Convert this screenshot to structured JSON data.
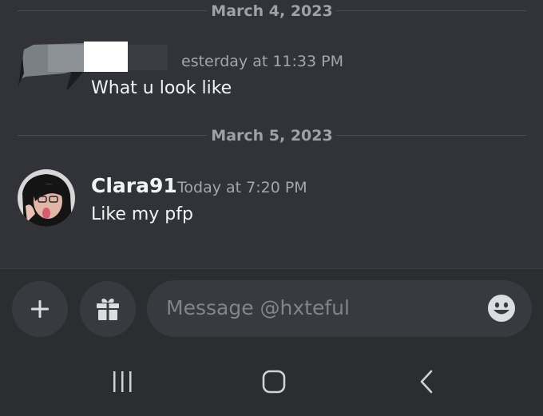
{
  "dividers": {
    "first": "March 4, 2023",
    "second": "March 5, 2023"
  },
  "message1": {
    "timestamp_visible": "esterday at 11:33 PM",
    "text": "What u look like"
  },
  "message2": {
    "author": "Clara91",
    "timestamp": "Today at 7:20 PM",
    "text": "Like my pfp"
  },
  "composer": {
    "placeholder": "Message @hxteful"
  },
  "icons": {
    "add": "plus-icon",
    "gift": "gift-icon",
    "emoji": "emoji-icon",
    "recents": "recent-apps-icon",
    "home": "home-icon",
    "back": "back-icon"
  },
  "colors": {
    "background": "#313338",
    "composer": "#2b2d31",
    "input": "#383a40",
    "muted_text": "#a3a6ad"
  }
}
